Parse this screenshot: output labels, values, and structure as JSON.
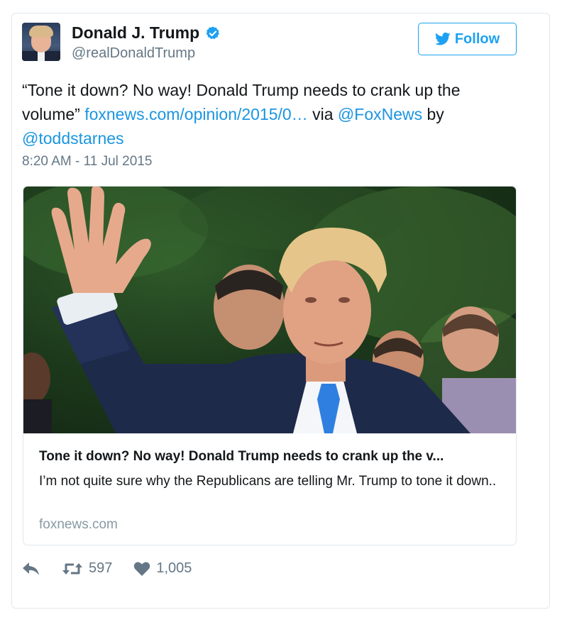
{
  "user": {
    "name": "Donald J. Trump",
    "handle": "@realDonaldTrump",
    "verified_icon": "verified-badge-icon"
  },
  "follow_button": {
    "label": "Follow",
    "icon": "twitter-bird-icon"
  },
  "tweet": {
    "text_part1": "“Tone it down? No way! Donald Trump needs to crank up the volume” ",
    "link": "foxnews.com/opinion/2015/0…",
    "text_part2": " via ",
    "mention1": "@FoxNews",
    "text_part3": " by ",
    "mention2": "@toddstarnes",
    "timestamp": "8:20 AM - 11 Jul 2015"
  },
  "link_card": {
    "title": "Tone it down? No way! Donald Trump needs to crank up the v...",
    "description": "I’m not quite sure why the Republicans are telling Mr. Trump to tone it down..",
    "domain": "foxnews.com"
  },
  "actions": {
    "retweet_count": "597",
    "like_count": "1,005"
  },
  "colors": {
    "link": "#1b95e0",
    "accent": "#1da1f2",
    "muted": "#657786"
  }
}
